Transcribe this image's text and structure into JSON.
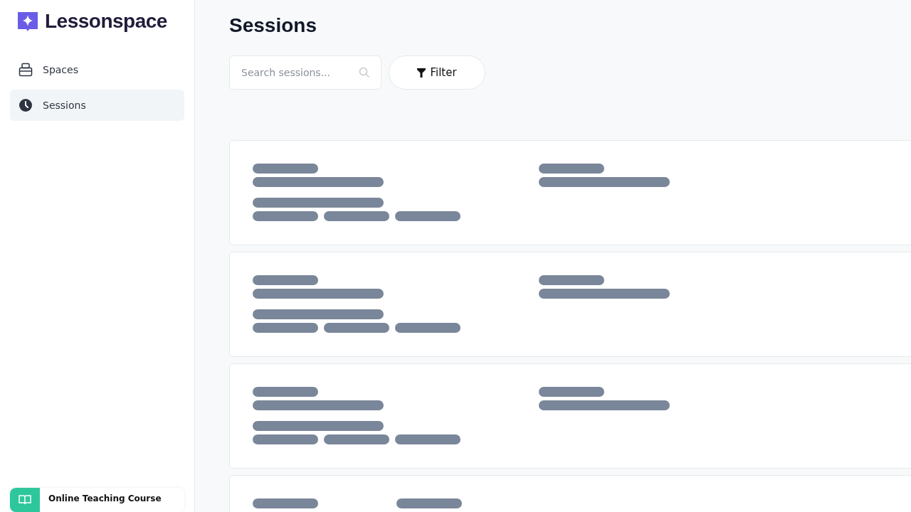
{
  "brand": {
    "name": "Lessonspace"
  },
  "nav": [
    {
      "label": "Spaces",
      "kind": "spaces",
      "selected": false
    },
    {
      "label": "Sessions",
      "kind": "sessions",
      "selected": true
    }
  ],
  "promo": {
    "title": "Online Teaching Course"
  },
  "page": {
    "title": "Sessions"
  },
  "search": {
    "placeholder": "Search sessions..."
  },
  "filter": {
    "label": "Filter"
  },
  "sessions": [
    {
      "kind": "skeleton"
    },
    {
      "kind": "skeleton"
    },
    {
      "kind": "skeleton"
    },
    {
      "kind": "skeleton"
    }
  ]
}
